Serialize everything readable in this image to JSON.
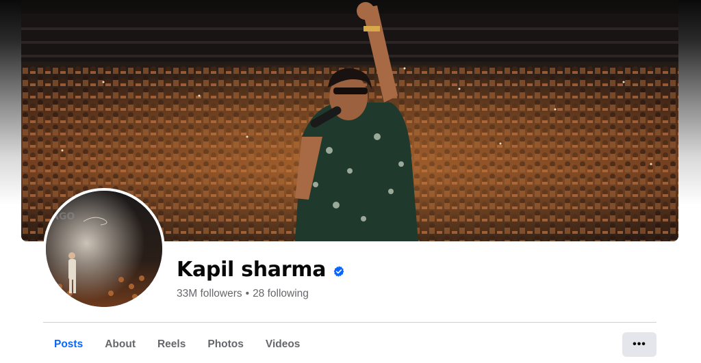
{
  "profile": {
    "name": "Kapil sharma",
    "verified": true,
    "followers": "33M followers",
    "separator": "•",
    "following": "28 following"
  },
  "tabs": [
    {
      "label": "Posts",
      "active": true
    },
    {
      "label": "About",
      "active": false
    },
    {
      "label": "Reels",
      "active": false
    },
    {
      "label": "Photos",
      "active": false
    },
    {
      "label": "Videos",
      "active": false
    }
  ],
  "more_button": {
    "label": "•••",
    "icon": "more-horizontal-icon"
  },
  "colors": {
    "accent": "#0866ff",
    "verified_badge": "#0866ff",
    "secondary_text": "#65676b",
    "primary_text": "#080809",
    "button_bg": "#e4e6eb"
  },
  "cover_photo": {
    "description_icon": "concert-stage-photo"
  },
  "avatar": {
    "icon": "profile-photo"
  }
}
